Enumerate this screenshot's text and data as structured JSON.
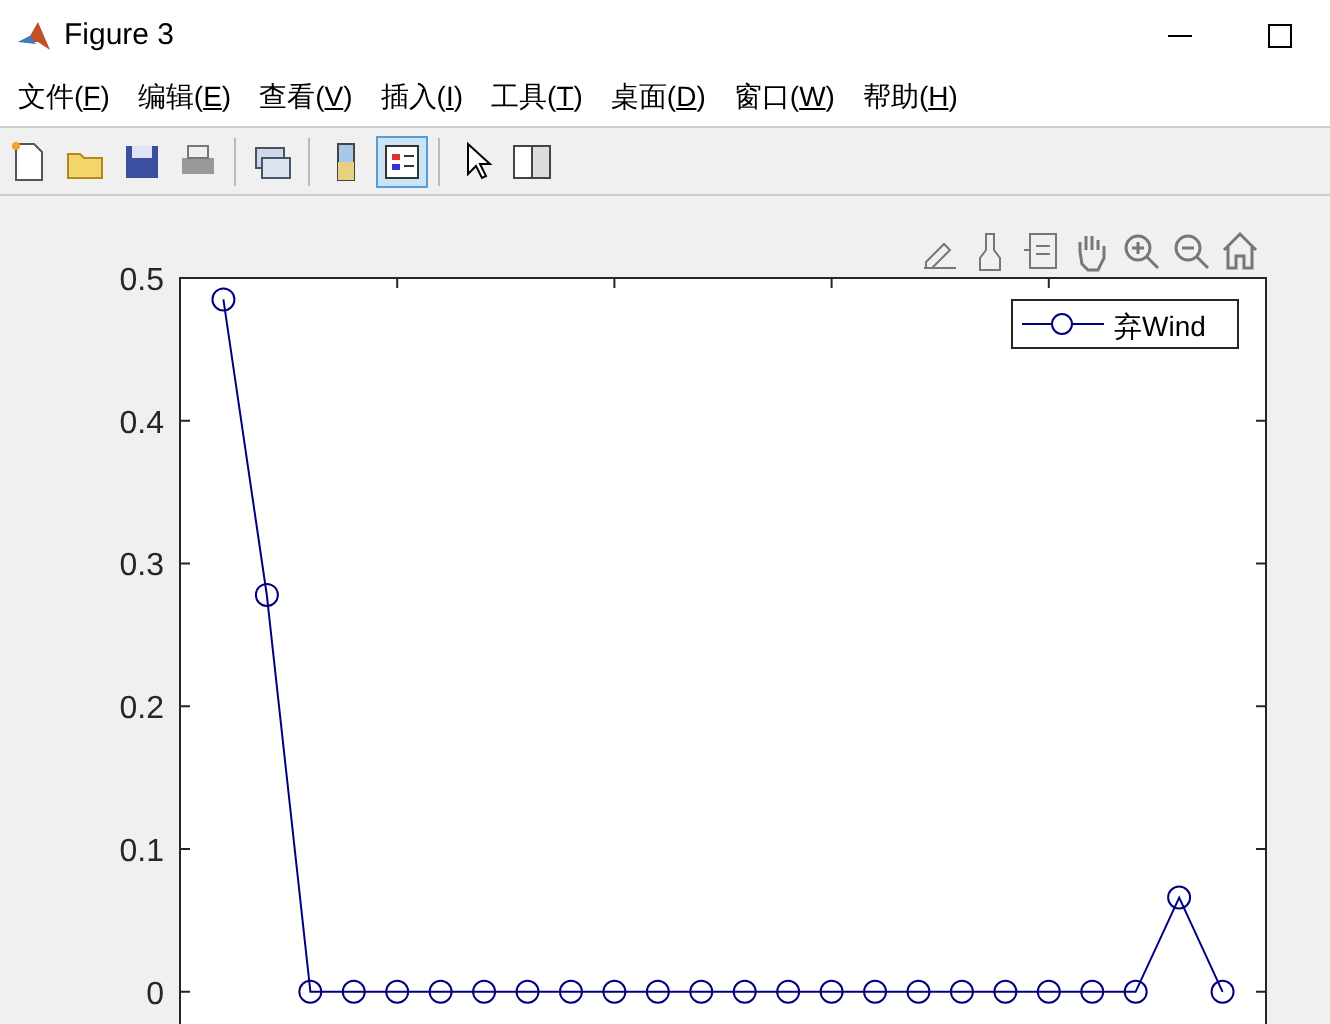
{
  "window": {
    "title": "Figure 3"
  },
  "menu": [
    {
      "label": "文件(",
      "key": "F",
      "end": ")"
    },
    {
      "label": "编辑(",
      "key": "E",
      "end": ")"
    },
    {
      "label": "查看(",
      "key": "V",
      "end": ")"
    },
    {
      "label": "插入(",
      "key": "I",
      "end": ")"
    },
    {
      "label": "工具(",
      "key": "T",
      "end": ")"
    },
    {
      "label": "桌面(",
      "key": "D",
      "end": ")"
    },
    {
      "label": "窗口(",
      "key": "W",
      "end": ")"
    },
    {
      "label": "帮助(",
      "key": "H",
      "end": ")"
    }
  ],
  "toolbar": [
    {
      "kind": "new",
      "selected": false
    },
    {
      "kind": "open",
      "selected": false
    },
    {
      "kind": "save",
      "selected": false
    },
    {
      "kind": "print",
      "selected": false
    },
    {
      "kind": "sep"
    },
    {
      "kind": "link",
      "selected": false
    },
    {
      "kind": "sep"
    },
    {
      "kind": "colorbar",
      "selected": false
    },
    {
      "kind": "legend",
      "selected": true
    },
    {
      "kind": "sep"
    },
    {
      "kind": "pointer",
      "selected": false
    },
    {
      "kind": "panel",
      "selected": false
    }
  ],
  "axes_toolbar": [
    {
      "kind": "edit"
    },
    {
      "kind": "brush"
    },
    {
      "kind": "datatip"
    },
    {
      "kind": "pan"
    },
    {
      "kind": "zoomin"
    },
    {
      "kind": "zoomout"
    },
    {
      "kind": "home"
    }
  ],
  "chart_data": {
    "type": "line",
    "categories": [
      null,
      null,
      null,
      null,
      null,
      null,
      null,
      null,
      null,
      null,
      null,
      null,
      null,
      null,
      null,
      null,
      null,
      null,
      null,
      null,
      null,
      null,
      null,
      null
    ],
    "series": [
      {
        "name": "弃Wind",
        "color": "#000080",
        "marker": "o",
        "values": [
          0.485,
          0.278,
          0,
          0,
          0,
          0,
          0,
          0,
          0,
          0,
          0,
          0,
          0,
          0,
          0,
          0,
          0,
          0,
          0,
          0,
          0,
          0,
          0.066,
          0
        ]
      }
    ],
    "ylim": [
      -0.024,
      0.5
    ],
    "yticks": [
      {
        "value": 0,
        "label": "0"
      },
      {
        "value": 0.1,
        "label": "0.1"
      },
      {
        "value": 0.2,
        "label": "0.2"
      },
      {
        "value": 0.3,
        "label": "0.3"
      },
      {
        "value": 0.4,
        "label": "0.4"
      },
      {
        "value": 0.5,
        "label": "0.5"
      }
    ]
  }
}
